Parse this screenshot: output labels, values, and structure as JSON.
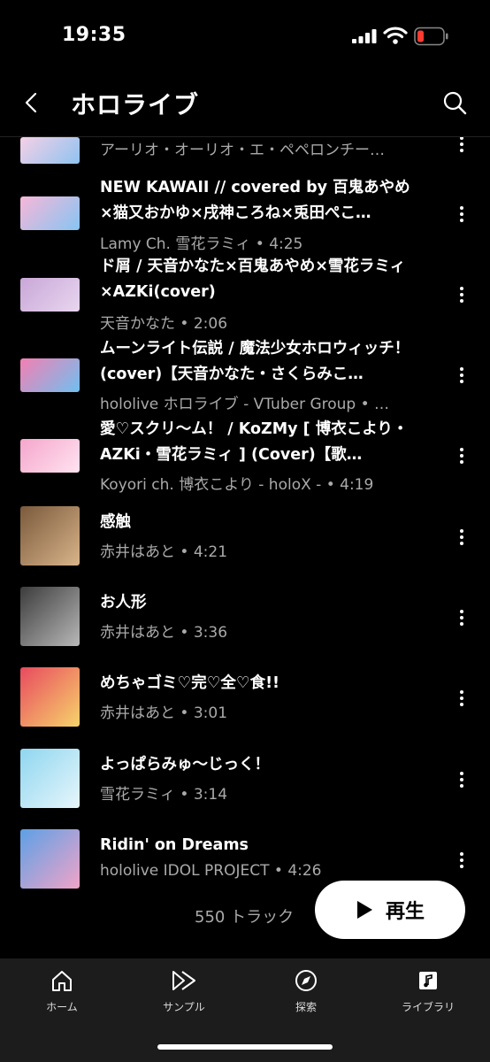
{
  "status_bar": {
    "time": "19:35"
  },
  "header": {
    "title": "ホロライブ"
  },
  "tracks": [
    {
      "title": "",
      "subtitle": "アーリオ・オーリオ・エ・ペペロンチー…",
      "colors": [
        "#f5d0e6",
        "#8fc3f0"
      ]
    },
    {
      "title": "NEW KAWAII // covered by 百鬼あやめ×猫又おかゆ×戌神ころね×兎田ぺこ…",
      "subtitle": "Lamy Ch. 雪花ラミィ • 4:25",
      "colors": [
        "#f7b7d8",
        "#86c5f2"
      ]
    },
    {
      "title": "ド屑 / 天音かなた×百鬼あやめ×雪花ラミィ×AZKi(cover)",
      "subtitle": "天音かなた • 2:06",
      "colors": [
        "#c9a7d8",
        "#e8d6ef"
      ]
    },
    {
      "title": "ムーンライト伝説 / 魔法少女ホロウィッチ！(cover)【天音かなた・さくらみこ…",
      "subtitle": "hololive ホロライブ - VTuber Group • …",
      "colors": [
        "#f47fb2",
        "#6fc0f0"
      ]
    },
    {
      "title": "愛♡スクリ〜ム！ / KoZMy [ 博衣こより・AZKi・雪花ラミィ ] (Cover)【歌…",
      "subtitle": "Koyori ch. 博衣こより - holoX - • 4:19",
      "colors": [
        "#f5a6cc",
        "#ffe3f0"
      ]
    },
    {
      "title": "感触",
      "subtitle": "赤井はあと • 4:21",
      "colors": [
        "#7a5a3c",
        "#d9b48a"
      ]
    },
    {
      "title": "お人形",
      "subtitle": "赤井はあと • 3:36",
      "colors": [
        "#3c3c3c",
        "#b8b8b8"
      ]
    },
    {
      "title": "めちゃゴミ♡完♡全♡食!!",
      "subtitle": "赤井はあと • 3:01",
      "colors": [
        "#e84a5f",
        "#f7d36b"
      ]
    },
    {
      "title": "よっぱらみゅ〜じっく！",
      "subtitle": "雪花ラミィ • 3:14",
      "colors": [
        "#8fd6f0",
        "#e7f6fb"
      ]
    },
    {
      "title": "Ridin' on Dreams",
      "subtitle": "hololive IDOL PROJECT • 4:26",
      "colors": [
        "#5da0e6",
        "#f0a4c8"
      ]
    }
  ],
  "footer": {
    "track_count": "550 トラック",
    "play_label": "再生"
  },
  "nav": {
    "items": [
      {
        "label": "ホーム",
        "icon": "home-icon"
      },
      {
        "label": "サンプル",
        "icon": "samples-icon"
      },
      {
        "label": "探索",
        "icon": "explore-icon"
      },
      {
        "label": "ライブラリ",
        "icon": "library-icon"
      }
    ]
  },
  "colors": {
    "background": "#000000",
    "subtitle": "#aaaaaa",
    "nav_background": "#1c1c1c",
    "battery_low": "#ff3b30"
  }
}
